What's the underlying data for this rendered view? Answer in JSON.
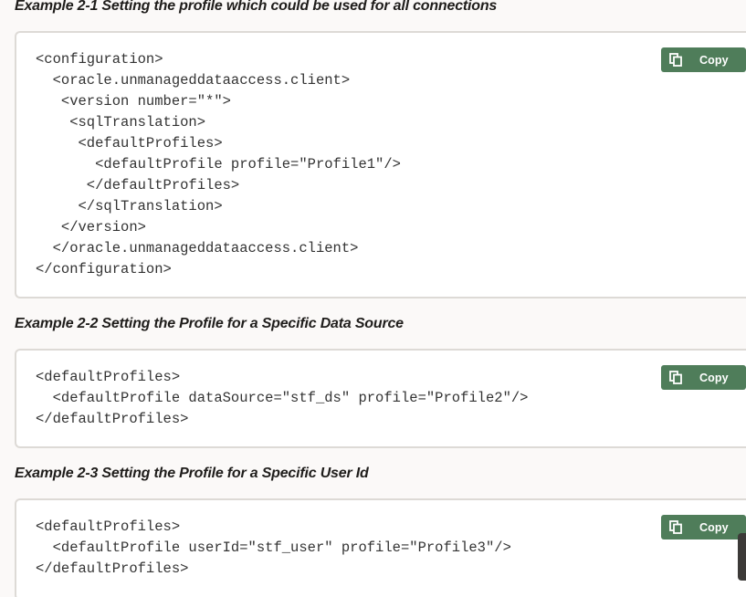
{
  "examples": [
    {
      "title": "Example 2-1 Setting the profile which could be used for all connections",
      "copy_label": "Copy",
      "code": "<configuration>\n  <oracle.unmanageddataaccess.client>\n   <version number=\"*\">\n    <sqlTranslation>\n     <defaultProfiles>\n       <defaultProfile profile=\"Profile1\"/>\n      </defaultProfiles>\n     </sqlTranslation>\n   </version>\n  </oracle.unmanageddataaccess.client>\n</configuration>"
    },
    {
      "title": "Example 2-2 Setting the Profile for a Specific Data Source",
      "copy_label": "Copy",
      "code": "<defaultProfiles>\n  <defaultProfile dataSource=\"stf_ds\" profile=\"Profile2\"/>\n</defaultProfiles>"
    },
    {
      "title": "Example 2-3 Setting the Profile for a Specific User Id",
      "copy_label": "Copy",
      "code": "<defaultProfiles>\n  <defaultProfile userId=\"stf_user\" profile=\"Profile3\"/>\n</defaultProfiles>"
    }
  ],
  "icons": {
    "copy": "copy-icon"
  },
  "colors": {
    "copy_button": "#4f7d5a",
    "code_border": "#dddad6",
    "background": "#fbf9f8"
  }
}
